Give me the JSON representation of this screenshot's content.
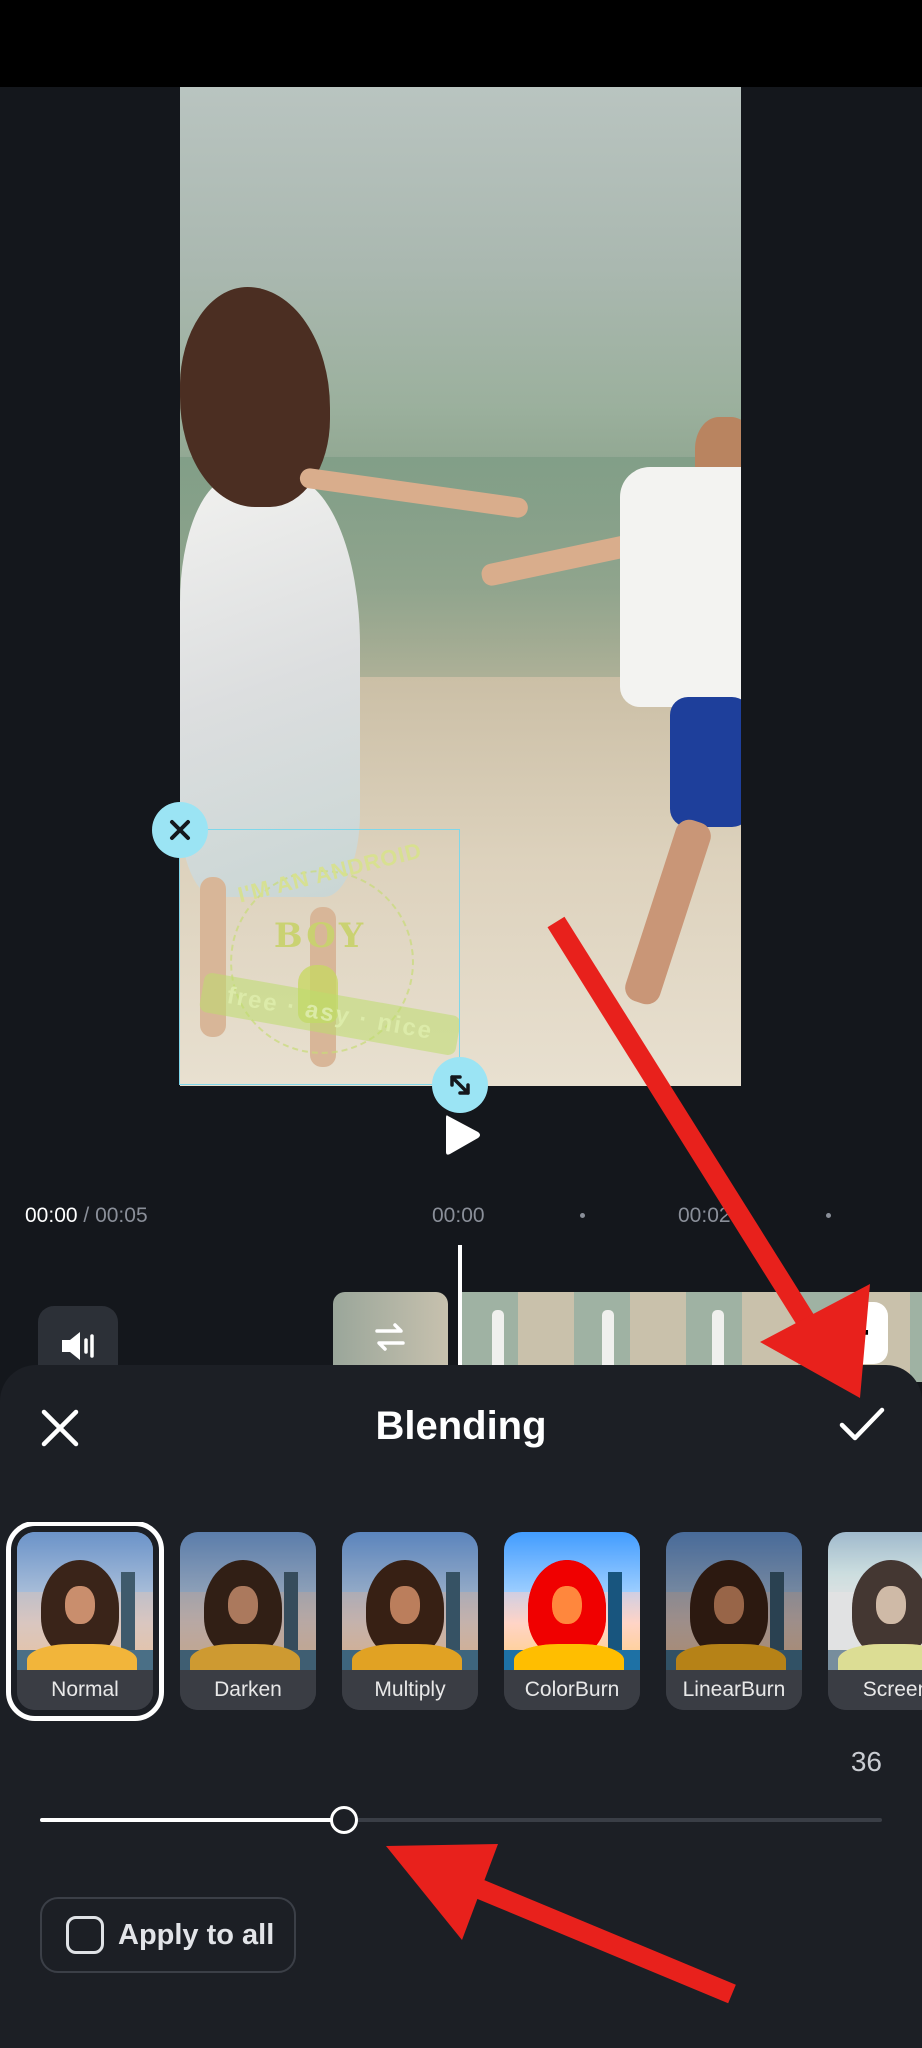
{
  "timeline": {
    "current": "00:00",
    "total": " / 00:05",
    "ticks": [
      "00:00",
      "00:02"
    ]
  },
  "panel": {
    "title": "Blending",
    "modes": [
      {
        "label": "Normal",
        "selected": true
      },
      {
        "label": "Darken"
      },
      {
        "label": "Multiply"
      },
      {
        "label": "ColorBurn"
      },
      {
        "label": "LinearBurn"
      },
      {
        "label": "Screen"
      }
    ],
    "opacity_value": "36",
    "opacity_fraction": 0.36,
    "apply_all_label": "Apply to all",
    "apply_all_checked": false
  },
  "watermark": {
    "top": "I'M AN ANDROID",
    "middle": "BOY",
    "bottom": "free · asy · nice"
  },
  "colors": {
    "annotation_arrow": "#e8211c",
    "selection_handle": "#9be4f4",
    "background": "#14171c",
    "sheet": "#1c1f25"
  },
  "icons": [
    "play-icon",
    "volume-icon",
    "swap-icon",
    "plus-icon",
    "close-icon",
    "check-icon",
    "resize-icon"
  ]
}
